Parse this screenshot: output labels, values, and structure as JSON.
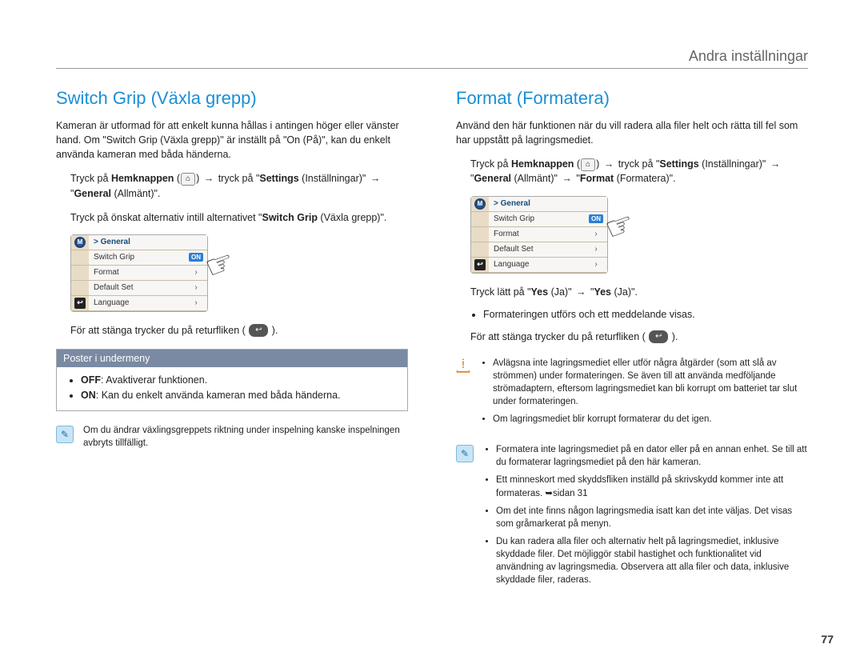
{
  "header": "Andra inställningar",
  "pageNumber": "77",
  "left": {
    "title": "Switch Grip (Växla grepp)",
    "intro": "Kameran är utformad för att enkelt kunna hållas i antingen höger eller vänster hand. Om \"Switch Grip (Växla grepp)\" är inställt på \"On (På)\", kan du enkelt använda kameran med båda händerna.",
    "navPrefix": "Tryck på ",
    "home": "Hemknappen",
    "navMid1": " tryck på \"",
    "settings": "Settings",
    "settingsParen": " (Inställningar)\"",
    "arrow": "→",
    "general": "General",
    "generalParen": " (Allmänt)\".",
    "quoteOpen": " \"",
    "step2a": "Tryck på önskat alternativ intill alternativet \"",
    "step2bold": "Switch Grip",
    "step2b": " (Växla grepp)\".",
    "closeLine": "För att stänga trycker du på returfliken ( ",
    "closeEnd": " ).",
    "menu": {
      "top": "> General",
      "r1": "Switch Grip",
      "r1badge": "ON",
      "r2": "Format",
      "r3": "Default Set",
      "r4": "Language"
    },
    "submenuHead": "Poster i undermeny",
    "off": "OFF",
    "offText": ": Avaktiverar funktionen.",
    "on": "ON",
    "onText": ": Kan du enkelt använda kameran med båda händerna.",
    "note": "Om du ändrar växlingsgreppets riktning under inspelning kanske inspelningen avbryts tillfälligt."
  },
  "right": {
    "title": "Format (Formatera)",
    "intro": "Använd den här funktionen när du vill radera alla filer helt och rätta till fel som har uppstått på lagringsmediet.",
    "navPrefix": "Tryck på ",
    "home": "Hemknappen",
    "navMid1": " tryck på \"",
    "settings": "Settings",
    "settingsParen": " (Inställningar)\"",
    "arrow": "→",
    "quoteOpen": " \"",
    "general": "General",
    "generalParen": " (Allmänt)\" ",
    "format": "Format",
    "formatParen": " (Formatera)\".",
    "menu": {
      "top": "> General",
      "r1": "Switch Grip",
      "r1badge": "ON",
      "r2": "Format",
      "r3": "Default Set",
      "r4": "Language"
    },
    "yesLine1a": "Tryck lätt på \"",
    "yes": "Yes",
    "yesParen": " (Ja)\" ",
    "yesLine1b": "\"",
    "yesParen2": " (Ja)\".",
    "bullet1": "Formateringen utförs och ett meddelande visas.",
    "closeLine": "För att stänga trycker du på returfliken ( ",
    "closeEnd": " ).",
    "warn": {
      "w1": "Avlägsna inte lagringsmediet eller utför några åtgärder (som att slå av strömmen) under formateringen. Se även till att använda medföljande strömadaptern, eftersom lagringsmediet kan bli korrupt om batteriet tar slut under formateringen.",
      "w2": "Om lagringsmediet blir korrupt formaterar du det igen."
    },
    "note": {
      "n1": "Formatera inte lagringsmediet på en dator eller på en annan enhet. Se till att du formaterar lagringsmediet på den här kameran.",
      "n2": "Ett minneskort med skyddsfliken inställd på skrivskydd kommer inte att formateras. ➥sidan 31",
      "n3": "Om det inte finns någon lagringsmedia isatt kan det inte väljas. Det visas som gråmarkerat på menyn.",
      "n4": "Du kan radera alla filer och alternativ helt på lagringsmediet, inklusive skyddade filer. Det möjliggör stabil hastighet och funktionalitet vid användning av lagringsmedia. Observera att alla filer och data, inklusive skyddade filer, raderas."
    }
  }
}
